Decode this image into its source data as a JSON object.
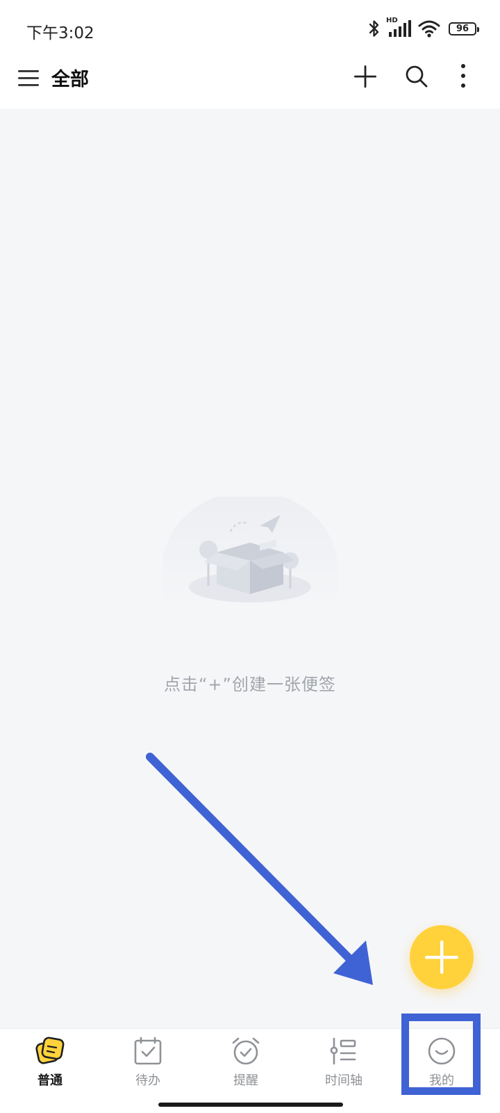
{
  "status_bar": {
    "time": "下午3:02",
    "network_badge": "HD",
    "battery_level": "96"
  },
  "app_bar": {
    "title": "全部",
    "icons": [
      "menu-icon",
      "add-icon",
      "search-icon",
      "more-icon"
    ]
  },
  "empty_state": {
    "hint": "点击“+”创建一张便签"
  },
  "bottom_nav": {
    "items": [
      {
        "label": "普通",
        "icon": "note-icon",
        "active": true
      },
      {
        "label": "待办",
        "icon": "todo-calendar-icon",
        "active": false
      },
      {
        "label": "提醒",
        "icon": "alarm-clock-icon",
        "active": false
      },
      {
        "label": "时间轴",
        "icon": "timeline-icon",
        "active": false
      },
      {
        "label": "我的",
        "icon": "smiley-face-icon",
        "active": false
      }
    ]
  },
  "colors": {
    "accent": "#ffd23c",
    "annotation": "#3f62d4",
    "background": "#f5f6f8"
  }
}
